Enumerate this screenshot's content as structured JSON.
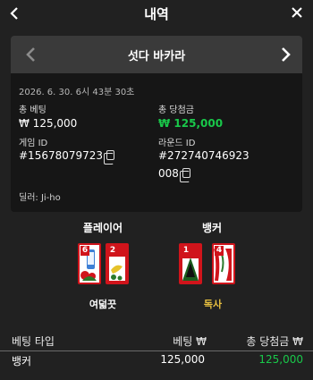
{
  "header": {
    "title": "내역"
  },
  "game": {
    "name": "섯다 바카라"
  },
  "detail": {
    "datetime": "2026. 6. 30. 6시 43분 30초",
    "total_bet_label": "총 베팅",
    "total_bet_value": "₩ 125,000",
    "total_win_label": "총 당첨금",
    "total_win_value": "₩ 125,000",
    "game_id_label": "게임 ID",
    "game_id_value": "#15678079723",
    "round_id_label": "라운드 ID",
    "round_id_line1": "#272740746923",
    "round_id_line2": "008",
    "dealer": "딜러: Ji-ho"
  },
  "player": {
    "label": "플레이어",
    "cards": [
      "6",
      "2"
    ],
    "result": "여덟끗"
  },
  "banker": {
    "label": "뱅커",
    "cards": [
      "1",
      "4"
    ],
    "result": "독사"
  },
  "table": {
    "headers": [
      "베팅 타입",
      "베팅 ₩",
      "총 당첨금 ₩"
    ],
    "rows": [
      {
        "type": "뱅커",
        "bet": "125,000",
        "win": "125,000"
      }
    ]
  },
  "colors": {
    "win_green": "#19c84a",
    "card_red": "#d0141b",
    "banker_result": "#e8c040"
  }
}
